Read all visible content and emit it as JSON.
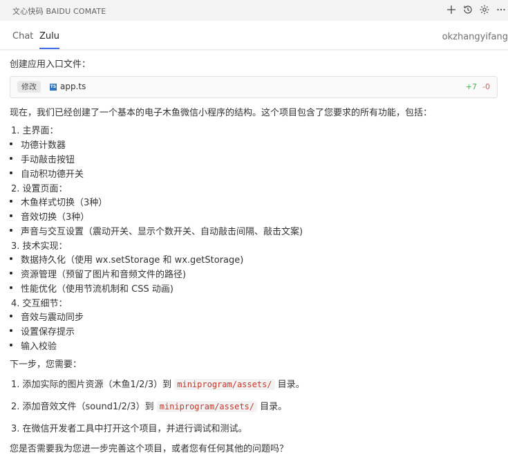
{
  "app": {
    "title": "文心快码 BAIDU COMATE"
  },
  "header_icons": [
    "plus-icon",
    "history-icon",
    "gear-icon",
    "more-icon"
  ],
  "tabs": [
    {
      "label": "Chat",
      "active": false
    },
    {
      "label": "Zulu",
      "active": true
    }
  ],
  "user": {
    "name": "okzhangyifang"
  },
  "message": {
    "intro": "创建应用入口文件：",
    "file_change": {
      "badge": "修改",
      "file_icon": "TS",
      "filename": "app.ts",
      "additions": "+7",
      "deletions": "-0"
    },
    "summary": "现在，我们已经创建了一个基本的电子木鱼微信小程序的结构。这个项目包含了您要求的所有功能，包括：",
    "sections": [
      {
        "title": "1. 主界面：",
        "items": [
          "功德计数器",
          "手动敲击按钮",
          "自动积功德开关"
        ]
      },
      {
        "title": "2. 设置页面：",
        "items": [
          "木鱼样式切换（3种）",
          "音效切换（3种）",
          "声音与交互设置（震动开关、显示个数开关、自动敲击间隔、敲击文案)"
        ]
      },
      {
        "title": "3. 技术实现：",
        "items": [
          "数据持久化（使用 wx.setStorage 和 wx.getStorage)",
          "资源管理（预留了图片和音频文件的路径)",
          "性能优化（使用节流机制和 CSS 动画)"
        ]
      },
      {
        "title": "4. 交互细节：",
        "items": [
          "音效与震动同步",
          "设置保存提示",
          "输入校验"
        ]
      }
    ],
    "next_steps_label": "下一步，您需要：",
    "steps": [
      {
        "before": "1. 添加实际的图片资源（木鱼1/2/3）到",
        "code": "miniprogram/assets/",
        "after": "目录。"
      },
      {
        "before": "2. 添加音效文件（sound1/2/3）到",
        "code": "miniprogram/assets/",
        "after": "目录。"
      },
      {
        "before": "3. 在微信开发者工具中打开这个项目，并进行调试和测试。",
        "code": "",
        "after": ""
      }
    ],
    "closing": "您是否需要我为您进一步完善这个项目，或者您有任何其他的问题吗？"
  }
}
